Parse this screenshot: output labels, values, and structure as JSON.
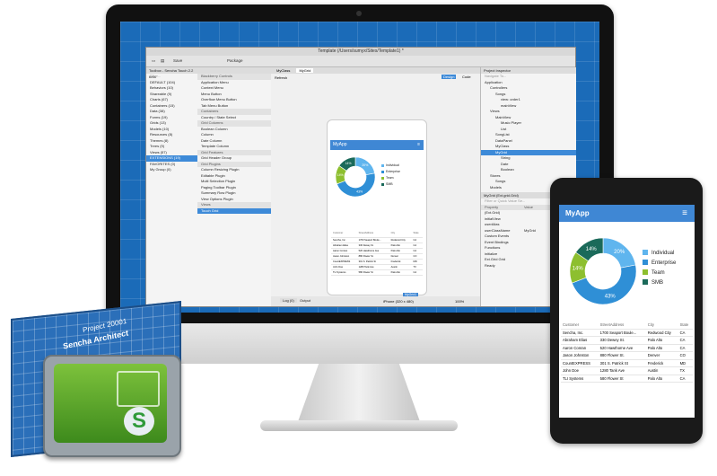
{
  "window": {
    "title": "Template (/Users/sumyx/Sites/Template1) *",
    "toolbar": {
      "save": "Save",
      "package": "Package"
    }
  },
  "toolbox": {
    "title": "Toolbox - Sencha Touch 2.2 beta",
    "filter": "Filter...",
    "categories": [
      "DEFAULT (104)",
      "Behaviors (10)",
      "Shareable (9)",
      "Charts (67)",
      "Containers (15)",
      "Data (38)",
      "Forms (19)",
      "Grids (13)",
      "Models (10)",
      "Resources (8)",
      "Themes (8)",
      "Trees (9)",
      "Views (57)"
    ],
    "selected_category": "EXTENSIONS (19)",
    "favorites": "FAVORITES (0)",
    "my_group": "My Group (0)",
    "items": [
      {
        "label": "Blackberry Controls",
        "group": true
      },
      {
        "label": "Application Menu"
      },
      {
        "label": "Context Menu"
      },
      {
        "label": "Menu Button"
      },
      {
        "label": "Overflow Menu Button"
      },
      {
        "label": "Tab Menu Button"
      },
      {
        "label": "Containers",
        "group": true
      },
      {
        "label": "Country / State Select"
      },
      {
        "label": "Grid Columns",
        "group": true
      },
      {
        "label": "Boolean Column"
      },
      {
        "label": "Column"
      },
      {
        "label": "Date Column"
      },
      {
        "label": "Template Column"
      },
      {
        "label": "Grid Features",
        "group": true
      },
      {
        "label": "Grid Header Group"
      },
      {
        "label": "Grid Plugins",
        "group": true
      },
      {
        "label": "Column Resizing Plugin"
      },
      {
        "label": "Editable Plugin"
      },
      {
        "label": "Multi Selection Plugin"
      },
      {
        "label": "Paging Toolbar Plugin"
      },
      {
        "label": "Summary Row Plugin"
      },
      {
        "label": "View Options Plugin"
      },
      {
        "label": "Views",
        "group": true
      },
      {
        "label": "Touch Grid",
        "selected": true
      }
    ]
  },
  "editor": {
    "tabs": [
      "MyClass",
      "MyGrid"
    ],
    "refresh": "Refresh",
    "design": "Design",
    "code": "Code",
    "device": "iPhone (320 x 480)",
    "zoom": "100%",
    "bottom_tabs": [
      "Log (0)",
      "Output"
    ],
    "badge": "MyGrid1"
  },
  "inspector": {
    "title": "Project Inspector",
    "filter": "Navigate To...",
    "tree": [
      {
        "label": "Application",
        "depth": 0
      },
      {
        "label": "Controllers",
        "depth": 1
      },
      {
        "label": "Songs",
        "depth": 2
      },
      {
        "label": "view: order1",
        "depth": 3
      },
      {
        "label": "mainView",
        "depth": 3
      },
      {
        "label": "Views",
        "depth": 1
      },
      {
        "label": "MainView",
        "depth": 2
      },
      {
        "label": "Music Player",
        "depth": 3
      },
      {
        "label": "List",
        "depth": 3
      },
      {
        "label": "SongList",
        "depth": 2
      },
      {
        "label": "DataPanel",
        "depth": 2
      },
      {
        "label": "MyClass",
        "depth": 2
      },
      {
        "label": "MyGrid",
        "depth": 2,
        "selected": true
      },
      {
        "label": "String",
        "depth": 3
      },
      {
        "label": "Date",
        "depth": 3
      },
      {
        "label": "Boolean",
        "depth": 3
      },
      {
        "label": "Stores",
        "depth": 1
      },
      {
        "label": "Songs",
        "depth": 2
      },
      {
        "label": "Models",
        "depth": 1
      }
    ],
    "config_title": "MyGrid (Ext.grid.Grid)",
    "config_search": "Filter or Quick Value Se...",
    "config_cols": [
      "Property",
      "Value"
    ],
    "config_rows": [
      {
        "name": "(Ext.Grid)",
        "value": ""
      },
      {
        "name": "initialView",
        "value": ""
      },
      {
        "name": "userAlias",
        "value": ""
      },
      {
        "name": "userClassName",
        "value": "MyGrid"
      },
      {
        "name": "Custom Events",
        "value": ""
      },
      {
        "name": "Event Bindings",
        "value": ""
      },
      {
        "name": "Functions",
        "value": ""
      },
      {
        "name": "initialize",
        "value": ""
      },
      {
        "name": "Ext.Grid Grid",
        "value": ""
      }
    ],
    "status": "Ready"
  },
  "app": {
    "title": "MyApp",
    "legend": [
      {
        "label": "Individual",
        "color": "#5fb5ee"
      },
      {
        "label": "Enterprise",
        "color": "#2f8fd6"
      },
      {
        "label": "Team",
        "color": "#8dbf2f"
      },
      {
        "label": "SMB",
        "color": "#1b6a5a"
      }
    ],
    "pie_labels": [
      "20%",
      "43%",
      "14%",
      "14%"
    ],
    "columns": [
      "Customer",
      "StreetAddress",
      "City",
      "State"
    ],
    "rows": [
      [
        "Sencha, Inc.",
        "1700 Seaport Boule...",
        "Redwood City",
        "CA"
      ],
      [
        "Abraham Elias",
        "330 Dewey St.",
        "Palo Alto",
        "CA"
      ],
      [
        "Aaron Conran",
        "520 Hawthorne Ave",
        "Palo Alto",
        "CA"
      ],
      [
        "Jason Johnston",
        "880 Flower St.",
        "Denver",
        "CO"
      ],
      [
        "CountEXPRESS",
        "301 S. Patrick St",
        "Frederick",
        "MD"
      ],
      [
        "John Doe",
        "1280 Tank Ave",
        "Austin",
        "TX"
      ],
      [
        "TLI Systems",
        "580 Flower St",
        "Palo Alto",
        "CA"
      ]
    ]
  },
  "icon": {
    "label": "Sencha Architect",
    "project": "Project 20001",
    "glyph": "S"
  },
  "chart_data": {
    "type": "pie",
    "categories": [
      "Individual",
      "Enterprise",
      "Team",
      "SMB"
    ],
    "values": [
      20,
      43,
      14,
      14
    ]
  }
}
